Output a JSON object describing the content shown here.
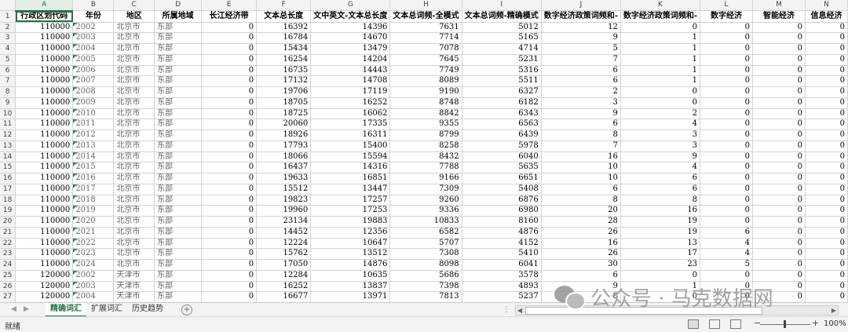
{
  "columns": [
    "A",
    "B",
    "C",
    "D",
    "E",
    "F",
    "G",
    "H",
    "I",
    "J",
    "K",
    "L",
    "M",
    "N"
  ],
  "selected_column": "A",
  "header_row": [
    "行政区划代码",
    "年份",
    "地区",
    "所属地域",
    "长江经济带",
    "文本总长度",
    "文中英文-文本总长度",
    "文本总词频-全模式",
    "文本总词频-精确模式",
    "数字经济政策词频和-",
    "数字经济政策词频和-",
    "数字经济",
    "智能经济",
    "信息经济"
  ],
  "rows": [
    [
      "110000",
      "2002",
      "北京市",
      "东部",
      "0",
      "16392",
      "14396",
      "7631",
      "5012",
      "12",
      "0",
      "0",
      "0",
      "0"
    ],
    [
      "110000",
      "2003",
      "北京市",
      "东部",
      "0",
      "16784",
      "14670",
      "7714",
      "5165",
      "9",
      "1",
      "0",
      "0",
      "0"
    ],
    [
      "110000",
      "2004",
      "北京市",
      "东部",
      "0",
      "15434",
      "13479",
      "7078",
      "4714",
      "5",
      "1",
      "0",
      "0",
      "0"
    ],
    [
      "110000",
      "2005",
      "北京市",
      "东部",
      "0",
      "16254",
      "14204",
      "7645",
      "5231",
      "7",
      "1",
      "0",
      "0",
      "0"
    ],
    [
      "110000",
      "2006",
      "北京市",
      "东部",
      "0",
      "16735",
      "14443",
      "7749",
      "5316",
      "6",
      "1",
      "0",
      "0",
      "0"
    ],
    [
      "110000",
      "2007",
      "北京市",
      "东部",
      "0",
      "17132",
      "14708",
      "8089",
      "5511",
      "6",
      "1",
      "0",
      "0",
      "0"
    ],
    [
      "110000",
      "2008",
      "北京市",
      "东部",
      "0",
      "19706",
      "17119",
      "9190",
      "6327",
      "2",
      "0",
      "0",
      "0",
      "0"
    ],
    [
      "110000",
      "2009",
      "北京市",
      "东部",
      "0",
      "18705",
      "16252",
      "8748",
      "6182",
      "3",
      "0",
      "0",
      "0",
      "0"
    ],
    [
      "110000",
      "2010",
      "北京市",
      "东部",
      "0",
      "18725",
      "16062",
      "8842",
      "6343",
      "9",
      "2",
      "0",
      "0",
      "0"
    ],
    [
      "110000",
      "2011",
      "北京市",
      "东部",
      "0",
      "20060",
      "17335",
      "9355",
      "6563",
      "6",
      "4",
      "0",
      "0",
      "0"
    ],
    [
      "110000",
      "2012",
      "北京市",
      "东部",
      "0",
      "18926",
      "16311",
      "8799",
      "6439",
      "8",
      "3",
      "0",
      "0",
      "0"
    ],
    [
      "110000",
      "2013",
      "北京市",
      "东部",
      "0",
      "17793",
      "15400",
      "8258",
      "5978",
      "7",
      "3",
      "0",
      "0",
      "0"
    ],
    [
      "110000",
      "2014",
      "北京市",
      "东部",
      "0",
      "18066",
      "15594",
      "8432",
      "6040",
      "16",
      "9",
      "0",
      "0",
      "0"
    ],
    [
      "110000",
      "2015",
      "北京市",
      "东部",
      "0",
      "16437",
      "14316",
      "7788",
      "5635",
      "10",
      "4",
      "0",
      "0",
      "0"
    ],
    [
      "110000",
      "2016",
      "北京市",
      "东部",
      "0",
      "19633",
      "16851",
      "9166",
      "6651",
      "10",
      "6",
      "0",
      "0",
      "0"
    ],
    [
      "110000",
      "2017",
      "北京市",
      "东部",
      "0",
      "15512",
      "13447",
      "7309",
      "5408",
      "6",
      "6",
      "0",
      "0",
      "0"
    ],
    [
      "110000",
      "2018",
      "北京市",
      "东部",
      "0",
      "19823",
      "17257",
      "9260",
      "6876",
      "8",
      "8",
      "0",
      "0",
      "0"
    ],
    [
      "110000",
      "2019",
      "北京市",
      "东部",
      "0",
      "19960",
      "17253",
      "9336",
      "6980",
      "20",
      "16",
      "0",
      "0",
      "0"
    ],
    [
      "110000",
      "2020",
      "北京市",
      "东部",
      "0",
      "23134",
      "19883",
      "10833",
      "8160",
      "28",
      "19",
      "0",
      "0",
      "0"
    ],
    [
      "110000",
      "2021",
      "北京市",
      "东部",
      "0",
      "14452",
      "12356",
      "6582",
      "4876",
      "26",
      "19",
      "6",
      "0",
      "0"
    ],
    [
      "110000",
      "2022",
      "北京市",
      "东部",
      "0",
      "12224",
      "10647",
      "5707",
      "4152",
      "16",
      "13",
      "4",
      "0",
      "0"
    ],
    [
      "110000",
      "2023",
      "北京市",
      "东部",
      "0",
      "15762",
      "13512",
      "7308",
      "5410",
      "26",
      "17",
      "4",
      "0",
      "0"
    ],
    [
      "110000",
      "2024",
      "北京市",
      "东部",
      "0",
      "17050",
      "14876",
      "8098",
      "6041",
      "30",
      "23",
      "5",
      "0",
      "0"
    ],
    [
      "120000",
      "2002",
      "天津市",
      "东部",
      "0",
      "12284",
      "10635",
      "5686",
      "3578",
      "6",
      "0",
      "0",
      "0",
      "0"
    ],
    [
      "120000",
      "2003",
      "天津市",
      "东部",
      "0",
      "16252",
      "13837",
      "7398",
      "4893",
      "9",
      "1",
      "0",
      "0",
      "0"
    ],
    [
      "120000",
      "2004",
      "天津市",
      "东部",
      "0",
      "16677",
      "13971",
      "7813",
      "5237",
      "8",
      "0",
      "0",
      "0",
      "0"
    ]
  ],
  "sheet_tabs": [
    {
      "label": "精确词汇",
      "active": true
    },
    {
      "label": "扩展词汇",
      "active": false
    },
    {
      "label": "历史趋势",
      "active": false
    }
  ],
  "add_sheet_symbol": "+",
  "status": {
    "ready": "就绪",
    "zoom": "100%"
  },
  "watermark": {
    "text": "公众号 · 马克数据网"
  },
  "colors": {
    "accent": "#217346",
    "grid": "#d4d4d4",
    "header_bg": "#f3f3f3"
  }
}
